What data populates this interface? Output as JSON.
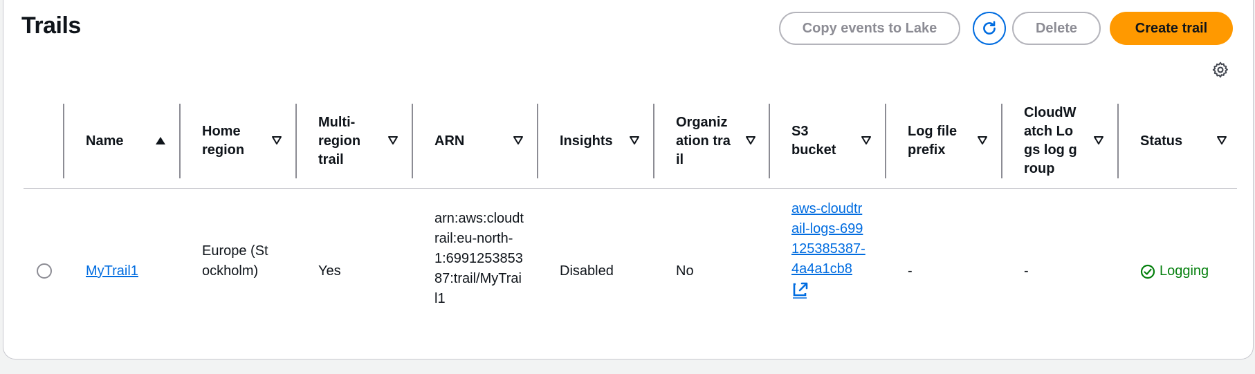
{
  "header": {
    "title": "Trails",
    "copy_events_label": "Copy events to Lake",
    "delete_label": "Delete",
    "create_trail_label": "Create trail"
  },
  "table": {
    "columns": [
      {
        "label": "Name",
        "sort": "ascending"
      },
      {
        "label": "Home region",
        "sort": "none"
      },
      {
        "label": "Multi-region trail",
        "sort": "none"
      },
      {
        "label": "ARN",
        "sort": "none"
      },
      {
        "label": "Insights",
        "sort": "none"
      },
      {
        "label": "Organization trail",
        "sort": "none"
      },
      {
        "label": "S3 bucket",
        "sort": "none"
      },
      {
        "label": "Log file prefix",
        "sort": "none"
      },
      {
        "label": "CloudWatch Logs log group",
        "sort": "none"
      },
      {
        "label": "Status",
        "sort": "none"
      }
    ],
    "rows": [
      {
        "name": "MyTrail1",
        "home_region": "Europe (Stockholm)",
        "multi_region": "Yes",
        "arn": "arn:aws:cloudtrail:eu-north-1:699125385387:trail/MyTrail1",
        "insights": "Disabled",
        "organization_trail": "No",
        "s3_bucket": "aws-cloudtrail-logs-699125385387-4a4a1cb8",
        "log_file_prefix": "-",
        "cloudwatch_log_group": "-",
        "status": "Logging"
      }
    ]
  },
  "colors": {
    "primary_button": "#ff9900",
    "link": "#006ce0",
    "success": "#037f0c"
  },
  "icons": {
    "refresh": "refresh-icon",
    "settings": "gear-icon",
    "external_link": "external-link-icon",
    "status_ok": "check-circle-icon"
  }
}
